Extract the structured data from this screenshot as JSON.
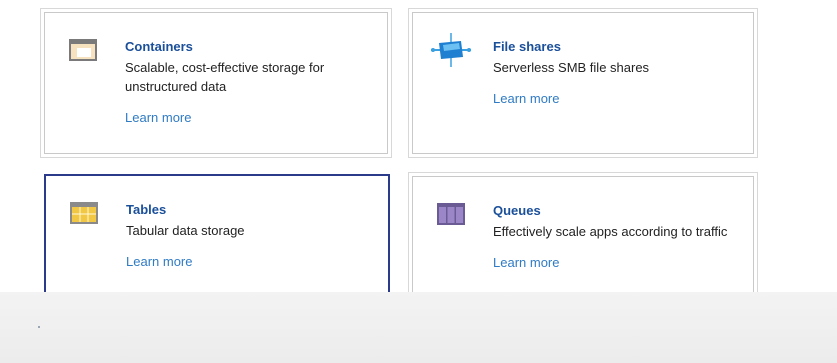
{
  "cards": [
    {
      "title": "Containers",
      "description": "Scalable, cost-effective storage for unstructured data",
      "link": "Learn more",
      "icon": "containers-icon"
    },
    {
      "title": "File shares",
      "description": "Serverless SMB file shares",
      "link": "Learn more",
      "icon": "file-shares-icon"
    },
    {
      "title": "Tables",
      "description": "Tabular data storage",
      "link": "Learn more",
      "icon": "tables-icon"
    },
    {
      "title": "Queues",
      "description": "Effectively scale apps according to traffic",
      "link": "Learn more",
      "icon": "queues-icon"
    }
  ],
  "colors": {
    "title": "#1a4f9a",
    "link": "#2f7bc4",
    "selected_border": "#2b3a8a"
  }
}
